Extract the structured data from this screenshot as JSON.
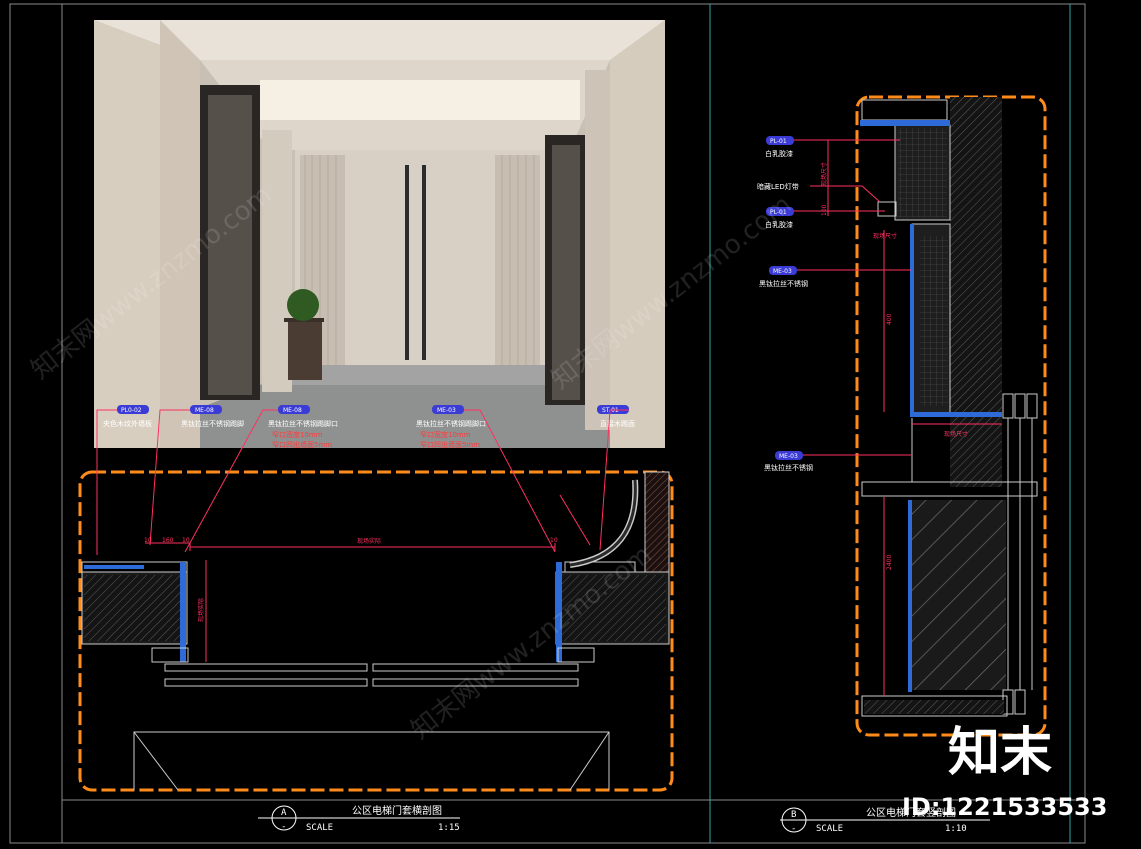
{
  "colors": {
    "border_orange": "#ff8c1a",
    "dim_magenta": "#ff3060",
    "tag_blue": "#3b3bd6",
    "wall_blue": "#2e6bd8",
    "frame_gray": "#8a8a8a"
  },
  "left_panel": {
    "callouts": [
      {
        "code": "PL0-02",
        "desc": "夹色木纹外墙板"
      },
      {
        "code": "ME-08",
        "desc": "黑钛拉丝不锈钢踢脚"
      },
      {
        "code": "ME-08",
        "desc": "黑钛拉丝不锈钢踢脚口",
        "note1": "窄口宽度10mm",
        "note2": "窄口凹出墙面5mm"
      },
      {
        "code": "ME-03",
        "desc": "黑钛拉丝不锈钢踢脚口",
        "note1": "窄口宽度10mm",
        "note2": "窄口凹出墙面5mm"
      },
      {
        "code": "ST-01",
        "desc": "直接木踢面"
      }
    ],
    "dims": {
      "d1": "10",
      "d2": "160",
      "d3": "10",
      "span": "现场实际",
      "depth": "现场实际",
      "d4": "10"
    },
    "title": "公区电梯门套横剖图",
    "label_id": "A",
    "label_sub": "-",
    "scale_label": "SCALE",
    "scale_value": "1:15"
  },
  "right_panel": {
    "callouts": [
      {
        "code": "PL-01",
        "desc": "白乳胶漆"
      },
      {
        "code": "",
        "desc": "暗藏LED灯带"
      },
      {
        "code": "PL-01",
        "desc": "白乳胶漆"
      },
      {
        "code": "ME-03",
        "desc": "黑钛拉丝不锈钢"
      },
      {
        "code": "ME-03",
        "desc": "黑钛拉丝不锈钢"
      }
    ],
    "dims": {
      "v1": "现场尺寸",
      "v2": "100",
      "ceiling_note": "现场尺寸",
      "h1": "400",
      "gap": "现场尺寸",
      "h2": "2400"
    },
    "title": "公区电梯门套竖剖图",
    "label_id": "B",
    "label_sub": "-",
    "scale_label": "SCALE",
    "scale_value": "1:10"
  },
  "watermark": {
    "brand_cn": "知末",
    "id_text": "ID:1221533533",
    "diag": "知末网www.znzmo.com"
  }
}
